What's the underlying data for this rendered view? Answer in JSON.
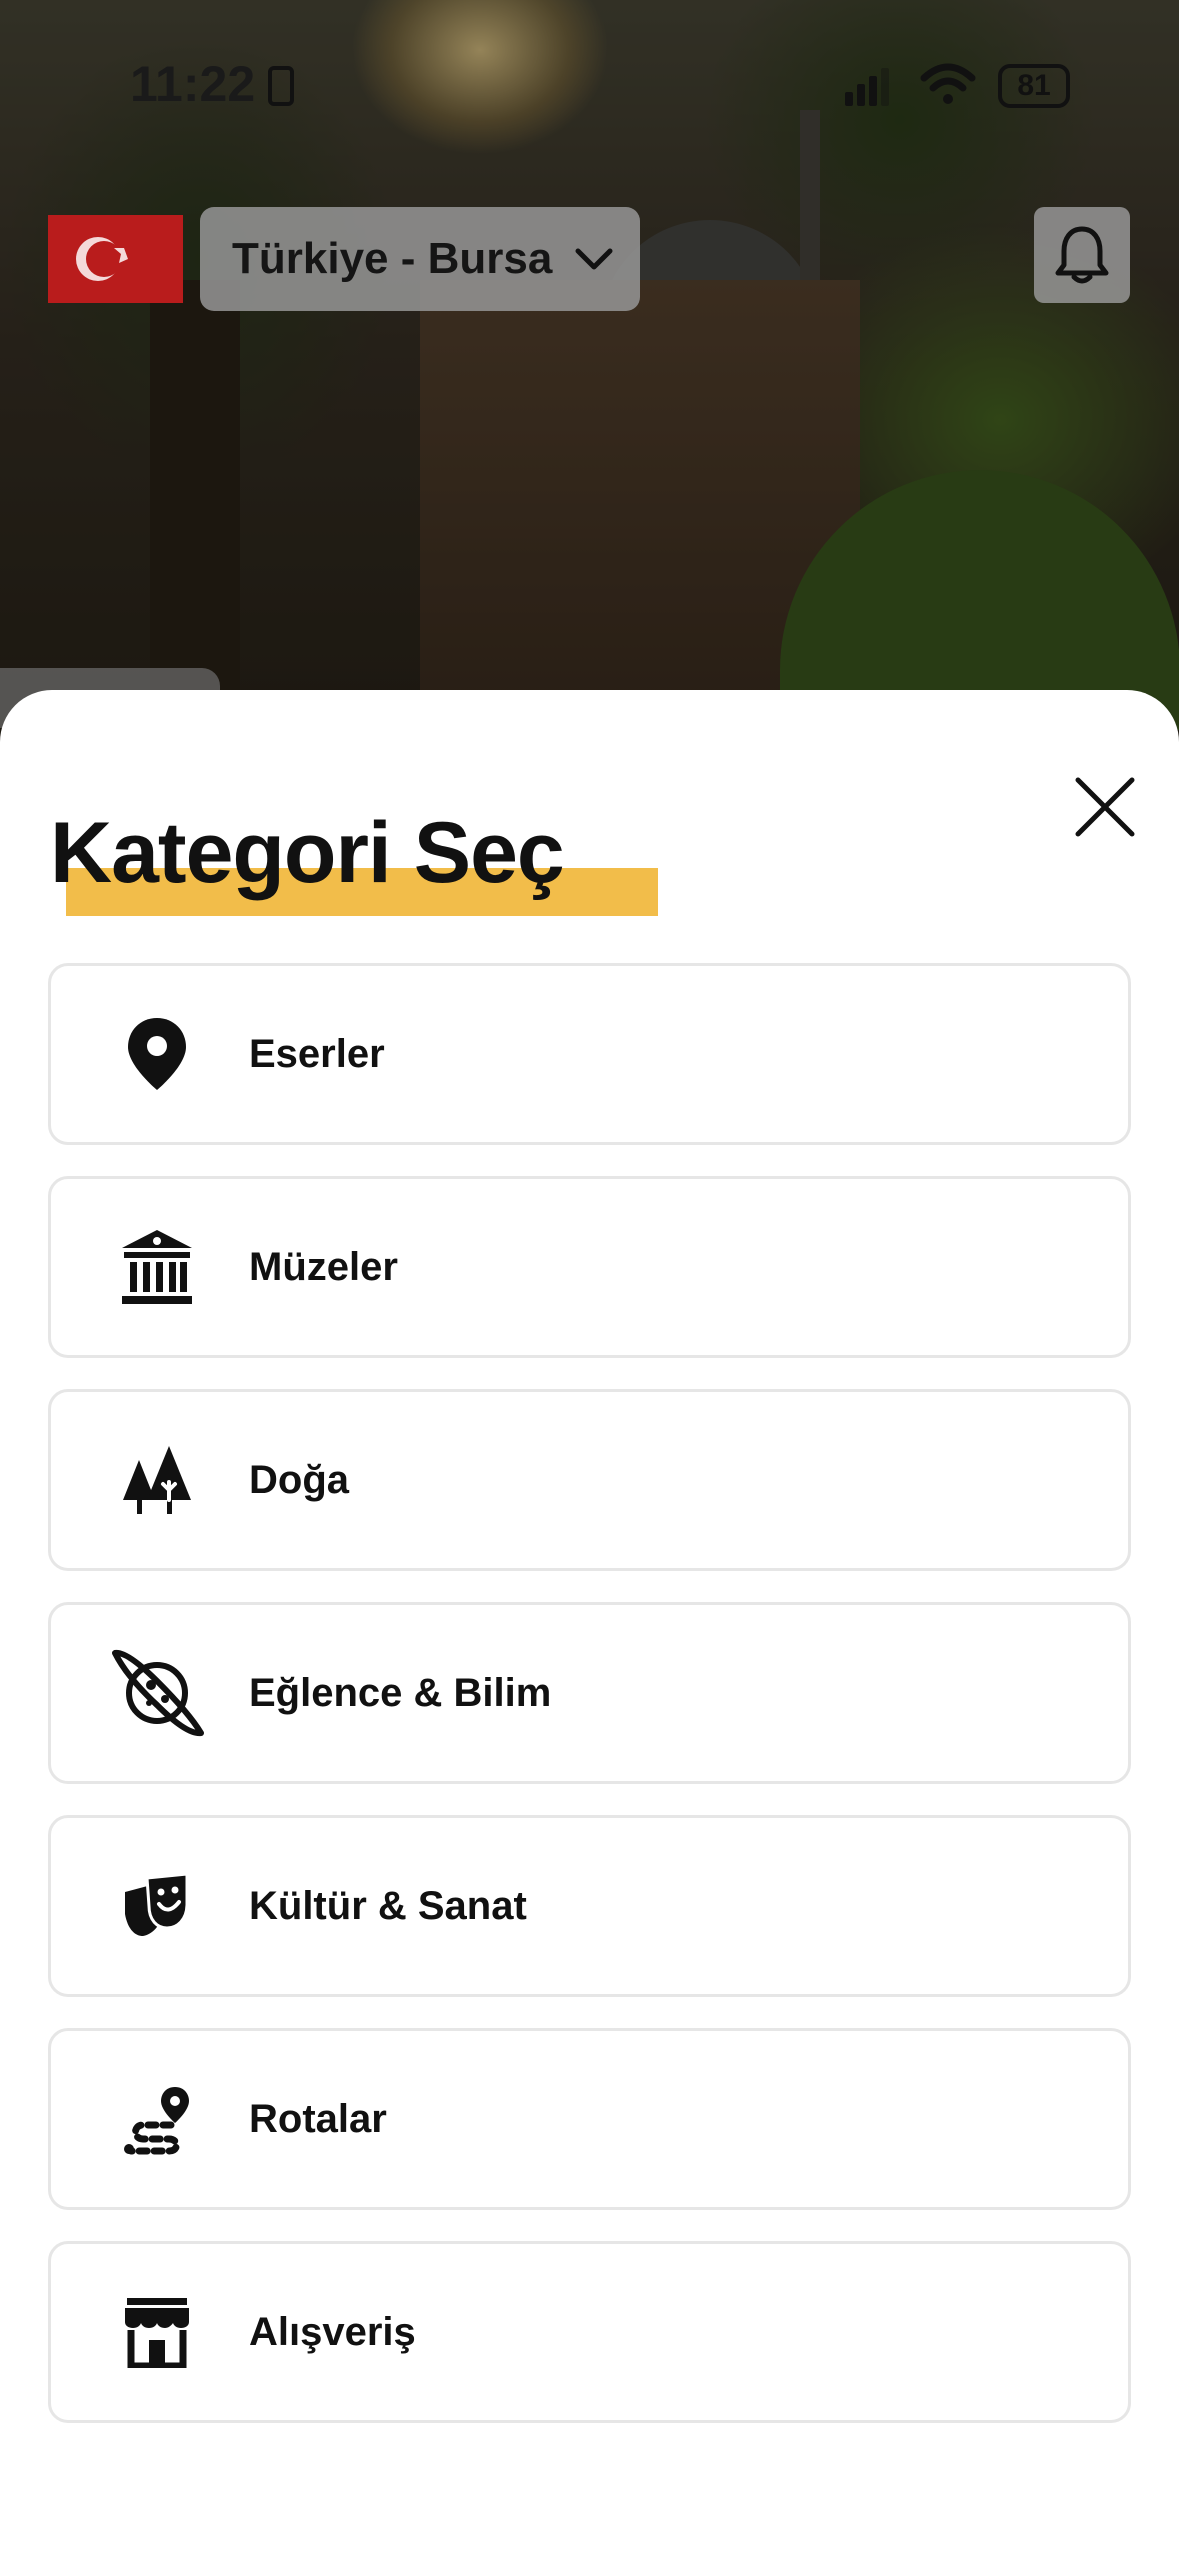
{
  "status_bar": {
    "time": "11:22",
    "battery": "81"
  },
  "header": {
    "location": "Türkiye - Bursa"
  },
  "sheet": {
    "title": "Kategori Seç",
    "highlight_color": "#f2bd4a",
    "categories": [
      {
        "label": "Eserler",
        "icon": "map-pin-icon"
      },
      {
        "label": "Müzeler",
        "icon": "museum-icon"
      },
      {
        "label": "Doğa",
        "icon": "trees-icon"
      },
      {
        "label": "Eğlence & Bilim",
        "icon": "planet-icon"
      },
      {
        "label": "Kültür & Sanat",
        "icon": "theater-masks-icon"
      },
      {
        "label": "Rotalar",
        "icon": "route-icon"
      },
      {
        "label": "Alışveriş",
        "icon": "store-icon"
      }
    ]
  }
}
